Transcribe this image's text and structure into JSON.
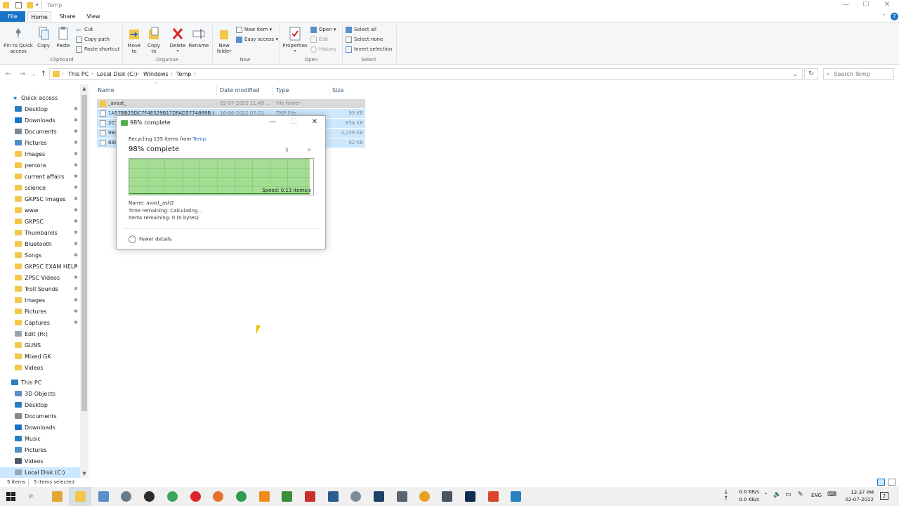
{
  "window": {
    "title": "Temp",
    "minimize": "—",
    "maximize": "☐",
    "close": "✕"
  },
  "ribbon_tabs": [
    "File",
    "Home",
    "Share",
    "View"
  ],
  "ribbon": {
    "clipboard": {
      "pin_label_1": "Pin to Quick",
      "pin_label_2": "access",
      "copy": "Copy",
      "paste": "Paste",
      "cut": "Cut",
      "copy_path": "Copy path",
      "paste_shortcut": "Paste shortcut",
      "group": "Clipboard"
    },
    "organise": {
      "move_to_1": "Move",
      "move_to_2": "to",
      "copy_to_1": "Copy",
      "copy_to_2": "to",
      "delete": "Delete",
      "rename": "Rename",
      "group": "Organise"
    },
    "new": {
      "new_folder_1": "New",
      "new_folder_2": "folder",
      "new_item": "New item",
      "easy_access": "Easy access",
      "group": "New"
    },
    "open": {
      "properties": "Properties",
      "open": "Open",
      "edit": "Edit",
      "history": "History",
      "group": "Open"
    },
    "select": {
      "select_all": "Select all",
      "select_none": "Select none",
      "invert_selection": "Invert selection",
      "group": "Select"
    }
  },
  "address": {
    "crumbs": [
      "This PC",
      "Local Disk (C:)",
      "Windows",
      "Temp"
    ],
    "search_placeholder": "Search Temp"
  },
  "nav": {
    "quick_access": "Quick access",
    "items": [
      {
        "label": "Desktop",
        "pinned": true,
        "icon": "desktop"
      },
      {
        "label": "Downloads",
        "pinned": true,
        "icon": "download"
      },
      {
        "label": "Documents",
        "pinned": true,
        "icon": "documents"
      },
      {
        "label": "Pictures",
        "pinned": true,
        "icon": "pictures"
      },
      {
        "label": "Images",
        "pinned": true,
        "icon": "folder"
      },
      {
        "label": "persons",
        "pinned": true,
        "icon": "folder"
      },
      {
        "label": "current affairs",
        "pinned": true,
        "icon": "folder"
      },
      {
        "label": "science",
        "pinned": true,
        "icon": "folder"
      },
      {
        "label": "GKPSC Images",
        "pinned": true,
        "icon": "folder"
      },
      {
        "label": "www",
        "pinned": true,
        "icon": "folder"
      },
      {
        "label": "GKPSC",
        "pinned": true,
        "icon": "folder"
      },
      {
        "label": "Thumbanils",
        "pinned": true,
        "icon": "folder"
      },
      {
        "label": "Bluetooth",
        "pinned": true,
        "icon": "folder"
      },
      {
        "label": "Songs",
        "pinned": true,
        "icon": "folder"
      },
      {
        "label": "GKPSC EXAM HELP",
        "pinned": true,
        "icon": "folder"
      },
      {
        "label": "ZPSC Videos",
        "pinned": true,
        "icon": "folder"
      },
      {
        "label": "Troll Sounds",
        "pinned": true,
        "icon": "folder"
      },
      {
        "label": "Images",
        "pinned": true,
        "icon": "folder"
      },
      {
        "label": "Pictures",
        "pinned": true,
        "icon": "folder"
      },
      {
        "label": "Captures",
        "pinned": true,
        "icon": "folder"
      },
      {
        "label": "Edit (H:)",
        "pinned": false,
        "icon": "drive"
      },
      {
        "label": "GUNS",
        "pinned": false,
        "icon": "folder"
      },
      {
        "label": "Mixed GK",
        "pinned": false,
        "icon": "folder"
      },
      {
        "label": "Videos",
        "pinned": false,
        "icon": "folder"
      }
    ],
    "this_pc": "This PC",
    "pc_items": [
      {
        "label": "3D Objects",
        "icon": "3d"
      },
      {
        "label": "Desktop",
        "icon": "desktop"
      },
      {
        "label": "Documents",
        "icon": "documents"
      },
      {
        "label": "Downloads",
        "icon": "download"
      },
      {
        "label": "Music",
        "icon": "music"
      },
      {
        "label": "Pictures",
        "icon": "pictures"
      },
      {
        "label": "Videos",
        "icon": "videos"
      },
      {
        "label": "Local Disk (C:)",
        "icon": "drive"
      }
    ]
  },
  "columns": {
    "name": "Name",
    "date": "Date modified",
    "type": "Type",
    "size": "Size"
  },
  "files": [
    {
      "name": "_avast_",
      "date": "02-07-2022 11:49 ...",
      "type": "File folder",
      "size": "",
      "kind": "folder"
    },
    {
      "name": "1A57BB25DC7F4E529B17DFAD5774869B.t...",
      "date": "16-06-2022 07:21",
      "type": "TMP File",
      "size": "99 KB",
      "kind": "file"
    },
    {
      "name": "2C7",
      "date": "",
      "type": "",
      "size": "854 KB",
      "kind": "file"
    },
    {
      "name": "9E0",
      "date": "",
      "type": "",
      "size": "3,259 KB",
      "kind": "file"
    },
    {
      "name": "689",
      "date": "",
      "type": "",
      "size": "62 KB",
      "kind": "file"
    }
  ],
  "dialog": {
    "title": "98% complete",
    "line1_prefix": "Recycling 135 items from ",
    "line1_link": "Temp",
    "percent_text": "98% complete",
    "progress": 0.98,
    "speed": "Speed: 0.13 items/s",
    "name_label": "Name:",
    "name_value": "avast_ash2",
    "time_label": "Time remaining:",
    "time_value": "Calculating...",
    "items_label": "Items remaining:",
    "items_value": "0 (0 bytes)",
    "fewer_details": "Fewer details",
    "pause": "II",
    "cancel": "✕"
  },
  "status": {
    "items": "5 items",
    "selected": "5 items selected"
  },
  "taskbar": {
    "net_up": "0.0 KB/s",
    "net_down": "0.0 KB/s",
    "lang": "ENG",
    "time": "12:37 PM",
    "date": "02-07-2022",
    "notifications": "2"
  }
}
